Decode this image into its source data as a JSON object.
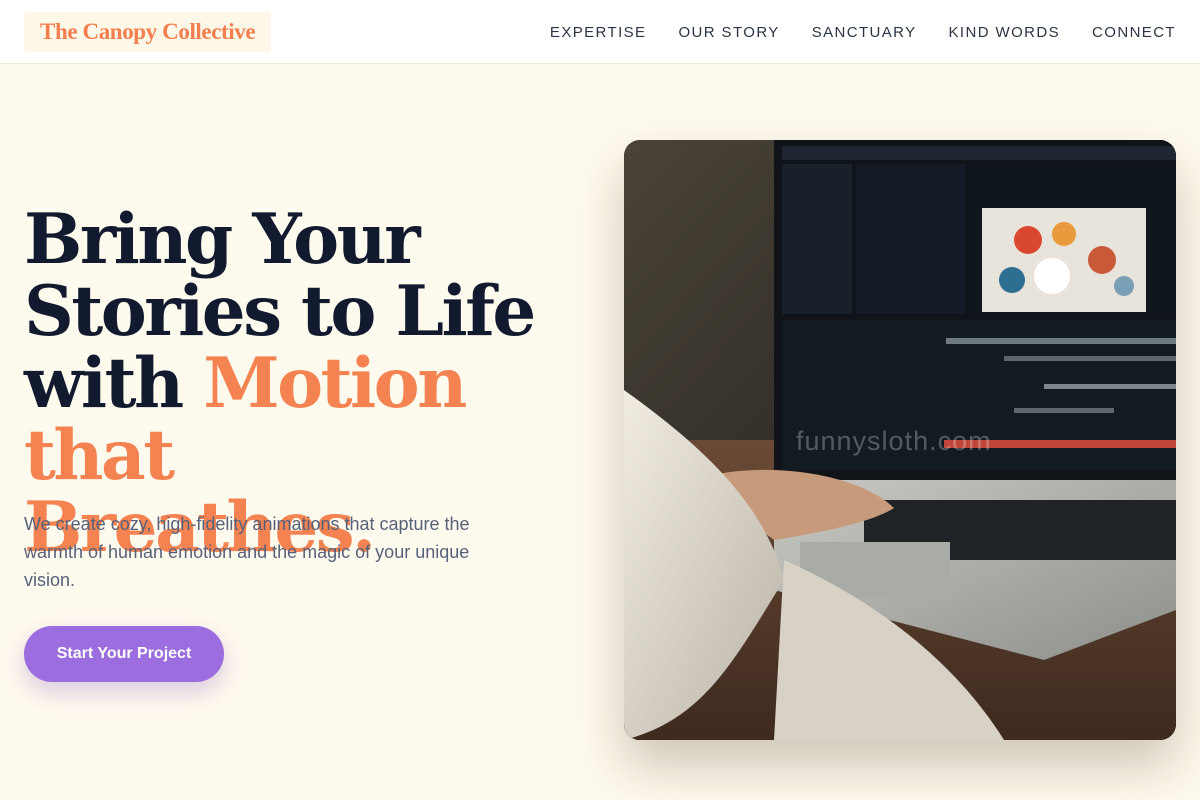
{
  "header": {
    "logo": "The Canopy Collective",
    "nav": [
      "EXPERTISE",
      "OUR STORY",
      "SANCTUARY",
      "KIND WORDS",
      "CONNECT"
    ]
  },
  "hero": {
    "headline_line1": "Bring Your",
    "headline_line2": "Stories to Life",
    "headline_with": "with",
    "headline_accent1": "Motion that",
    "headline_accent2": "Breathes.",
    "subtitle": "We create cozy, high-fidelity animations that capture the warmth of human emotion and the magic of your unique vision.",
    "cta_label": "Start Your Project",
    "image_watermark": "funnysloth.com"
  },
  "colors": {
    "background": "#fffaee",
    "accent": "#f58352",
    "heading": "#111a2f",
    "button": "#9b6dde",
    "body_text": "#56617a"
  }
}
